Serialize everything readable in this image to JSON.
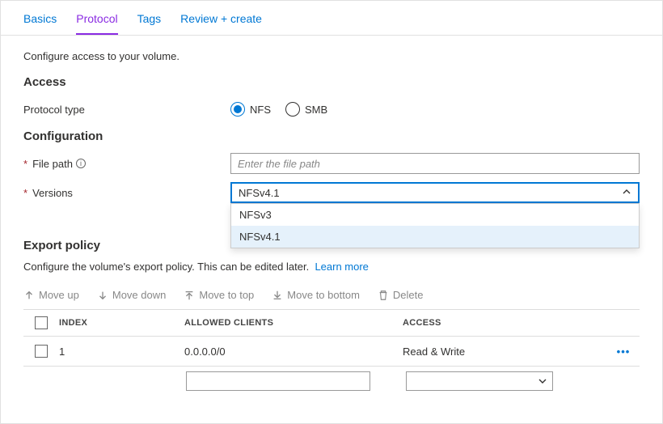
{
  "tabs": {
    "basics": "Basics",
    "protocol": "Protocol",
    "tags": "Tags",
    "review": "Review + create"
  },
  "description": "Configure access to your volume.",
  "sections": {
    "access": "Access",
    "configuration": "Configuration",
    "export": "Export policy"
  },
  "labels": {
    "protocol_type": "Protocol type",
    "file_path": "File path",
    "versions": "Versions"
  },
  "protocol": {
    "nfs": "NFS",
    "smb": "SMB",
    "selected": "NFS"
  },
  "file_path": {
    "placeholder": "Enter the file path",
    "value": ""
  },
  "versions": {
    "selected": "NFSv4.1",
    "options": [
      "NFSv3",
      "NFSv4.1"
    ]
  },
  "export": {
    "desc": "Configure the volume's export policy. This can be edited later.",
    "learn_more": "Learn more"
  },
  "toolbar": {
    "move_up": "Move up",
    "move_down": "Move down",
    "move_top": "Move to top",
    "move_bottom": "Move to bottom",
    "delete": "Delete"
  },
  "grid": {
    "headers": {
      "index": "INDEX",
      "allowed": "ALLOWED CLIENTS",
      "access": "ACCESS"
    },
    "rows": [
      {
        "index": "1",
        "allowed": "0.0.0.0/0",
        "access": "Read & Write"
      }
    ]
  }
}
